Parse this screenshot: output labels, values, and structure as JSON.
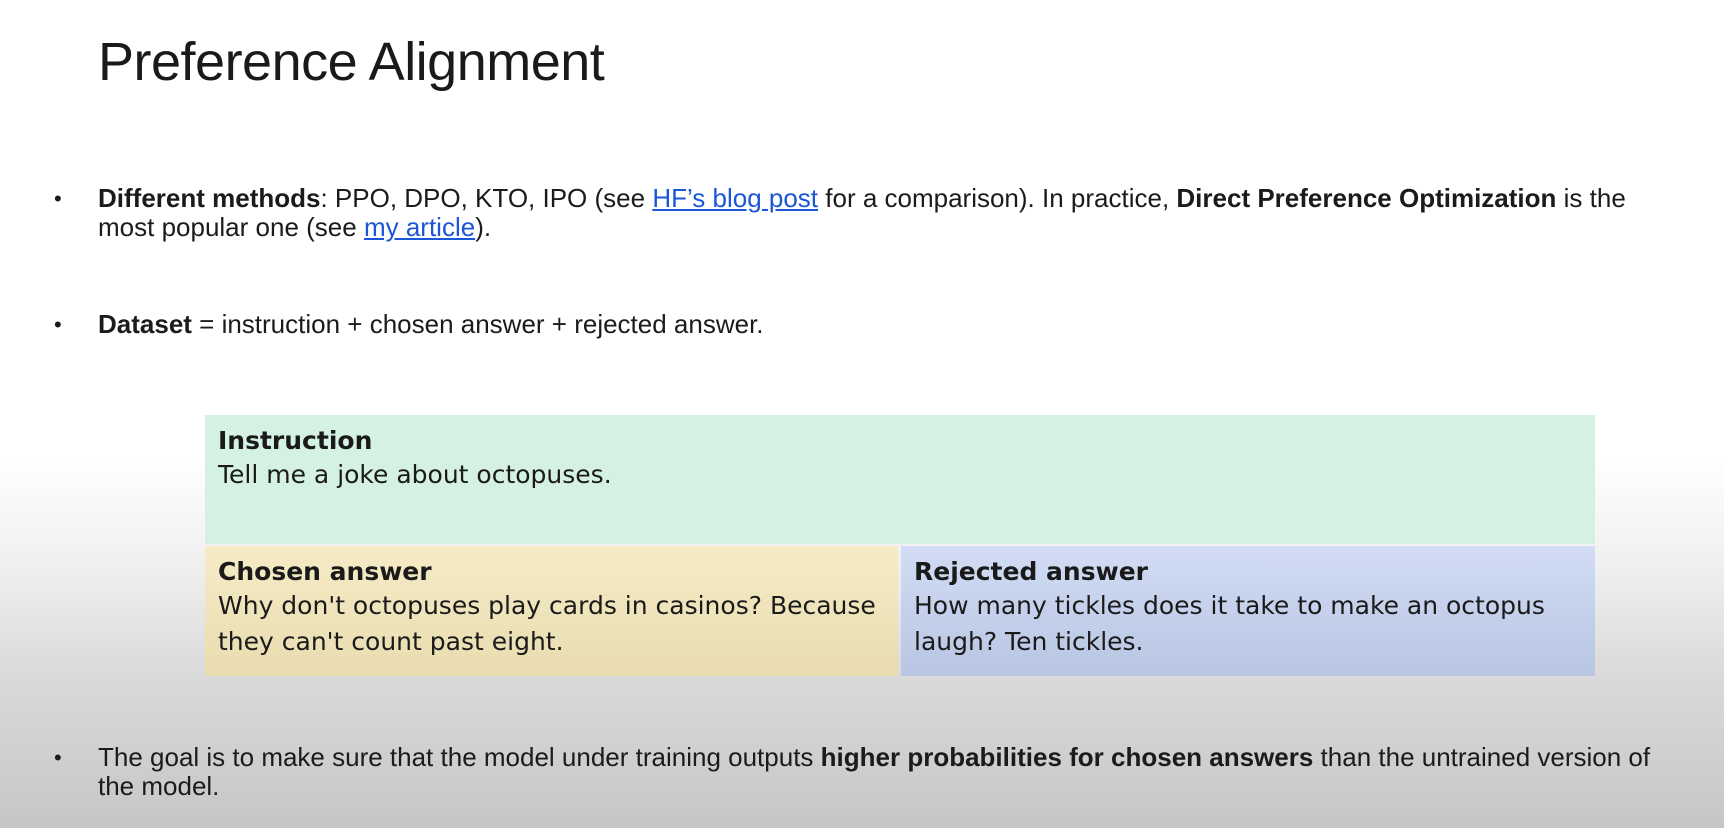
{
  "title": "Preference Alignment",
  "bullet_symbol": "•",
  "bullet1": {
    "bold1": "Different methods",
    "text1": ": PPO, DPO, KTO, IPO (see ",
    "link1": "HF’s blog post",
    "text2": " for a comparison). In practice, ",
    "bold2": "Direct Preference Optimization",
    "text3": " is the most popular one (see ",
    "link2": "my article",
    "text4": ")."
  },
  "bullet2": {
    "bold": "Dataset",
    "text": " = instruction + chosen answer + rejected answer."
  },
  "table": {
    "instruction_label": "Instruction",
    "instruction_text": "Tell me a joke about octopuses.",
    "chosen_label": "Chosen answer",
    "chosen_text": "Why don't octopuses play cards in casinos? Because they can't count past eight.",
    "rejected_label": "Rejected answer",
    "rejected_text": "How many tickles does it take to make an octopus laugh? Ten tickles."
  },
  "bullet3": {
    "text1": "The goal is to make sure that the model under training outputs ",
    "bold": "higher probabilities for chosen answers",
    "text2": " than the untrained version of the model."
  },
  "colors": {
    "instruction_bg": "#d4f1e3",
    "chosen_bg": "#f0e4be",
    "rejected_bg": "#c9d4ee",
    "link": "#1a56d6"
  }
}
